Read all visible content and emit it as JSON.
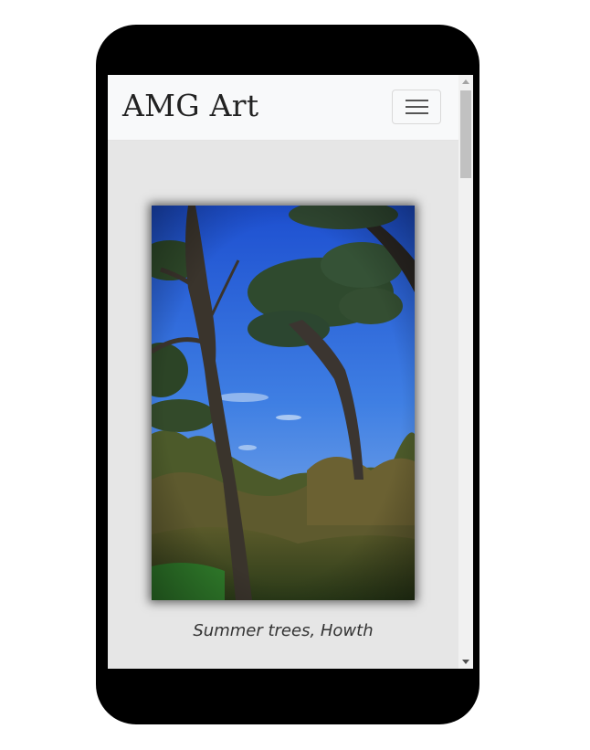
{
  "navbar": {
    "brand": "AMG Art",
    "menu_toggle_icon": "hamburger-icon"
  },
  "gallery": {
    "caption": "Summer trees, Howth",
    "image_subject": "trees"
  },
  "colors": {
    "phone_frame": "#000000",
    "navbar_bg": "#f8f9fa",
    "content_bg": "#e6e6e6",
    "brand_text": "#222222",
    "caption_text": "#333333"
  }
}
